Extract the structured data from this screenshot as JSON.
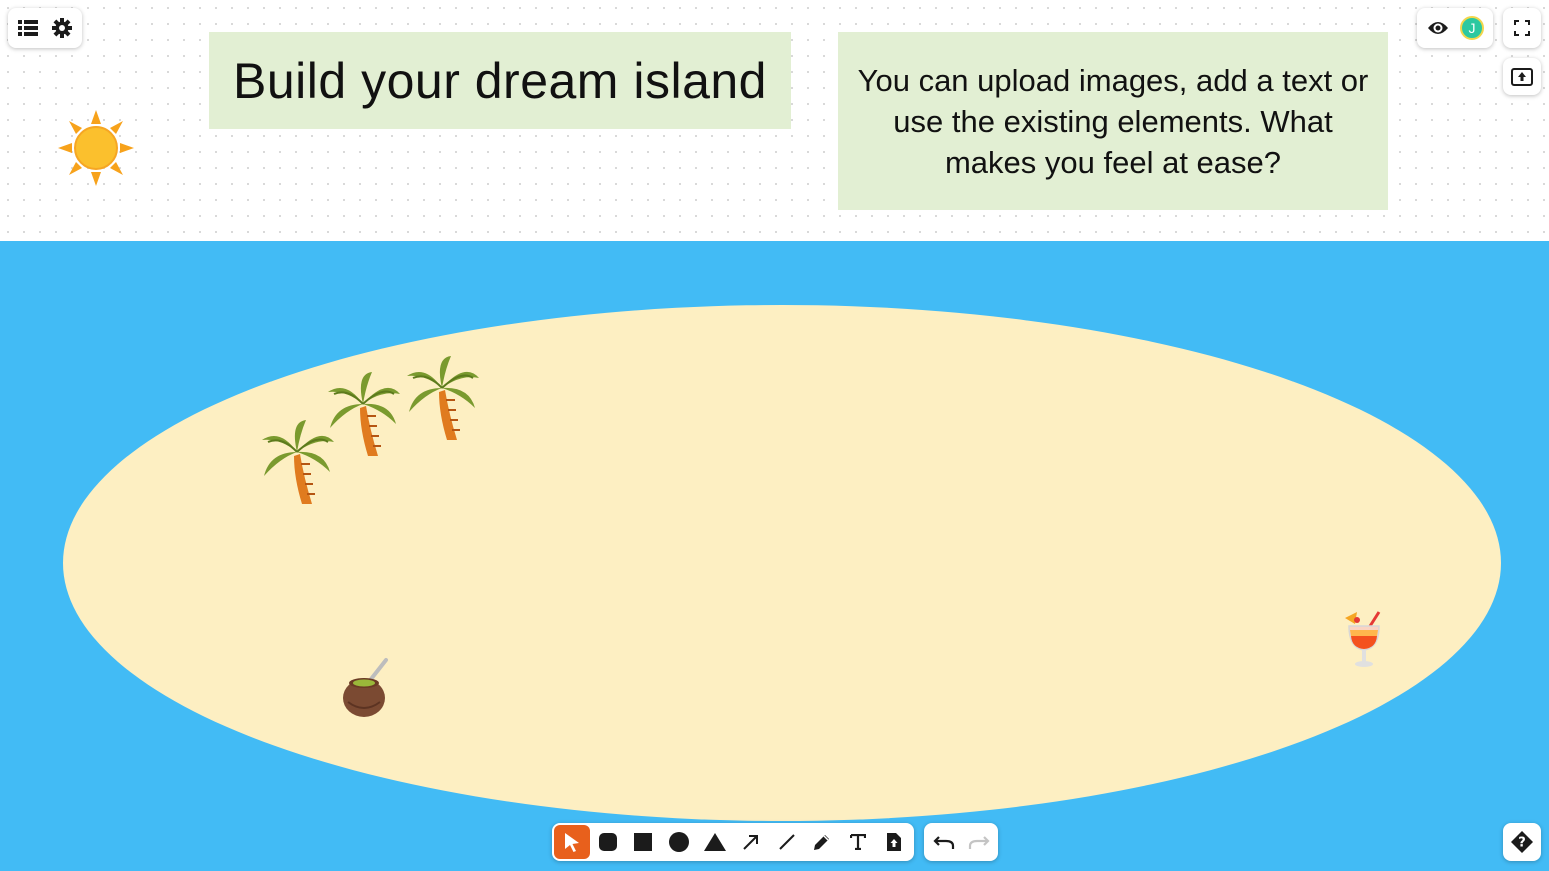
{
  "board": {
    "title_note": "Build your dream island",
    "info_note": "You can upload images, add a text or use the existing elements. What makes you feel at ease?",
    "sea_color": "#42bbf5",
    "sand_color": "#fdefc2",
    "note_color": "#e2efd3"
  },
  "emojis": {
    "sun": "sun-emoji",
    "palm_trees": [
      "palm-tree-emoji",
      "palm-tree-emoji",
      "palm-tree-emoji"
    ],
    "coconut_drink": "mate-drink-emoji",
    "cocktail": "tropical-drink-emoji"
  },
  "top_left": {
    "icons": [
      "menu-icon",
      "settings-icon"
    ]
  },
  "top_right": {
    "icons": [
      "eye-icon",
      "avatar",
      "fullscreen-icon",
      "export-icon"
    ],
    "avatar_initial": "J",
    "avatar_color": "#2bc8a0"
  },
  "toolbar": {
    "active_tool": "select",
    "active_color": "#e8601c",
    "tools": [
      "select-tool",
      "rounded-rectangle-tool",
      "rectangle-tool",
      "ellipse-tool",
      "triangle-tool",
      "arrow-tool",
      "line-tool",
      "pencil-tool",
      "text-tool",
      "upload-tool"
    ]
  },
  "history": {
    "tools": [
      "undo",
      "redo"
    ]
  },
  "help": {
    "icon": "help-icon"
  }
}
